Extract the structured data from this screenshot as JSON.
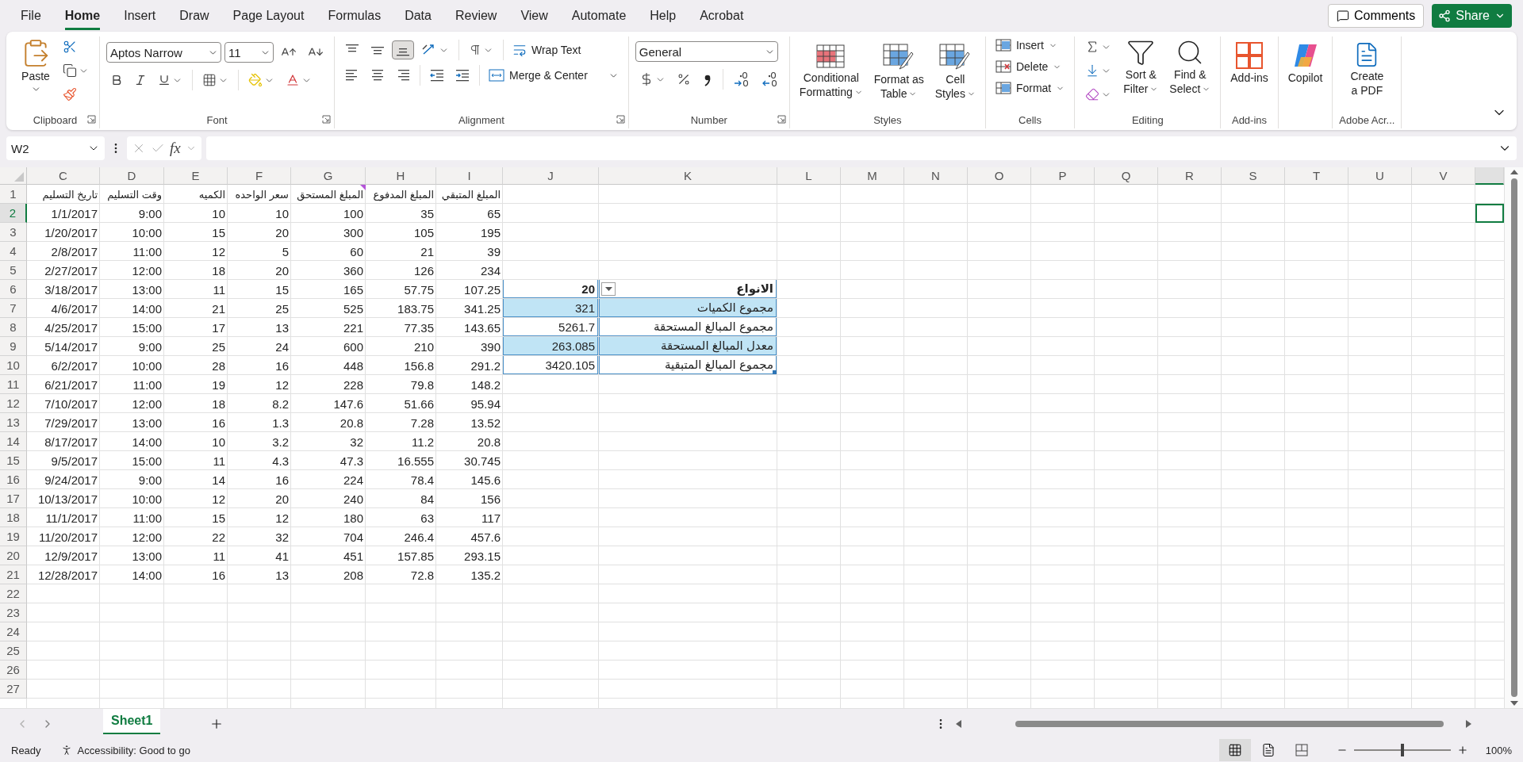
{
  "menu_tabs": [
    {
      "label": "File",
      "selected": false
    },
    {
      "label": "Home",
      "selected": true
    },
    {
      "label": "Insert",
      "selected": false
    },
    {
      "label": "Draw",
      "selected": false
    },
    {
      "label": "Page Layout",
      "selected": false
    },
    {
      "label": "Formulas",
      "selected": false
    },
    {
      "label": "Data",
      "selected": false
    },
    {
      "label": "Review",
      "selected": false
    },
    {
      "label": "View",
      "selected": false
    },
    {
      "label": "Automate",
      "selected": false
    },
    {
      "label": "Help",
      "selected": false
    },
    {
      "label": "Acrobat",
      "selected": false
    }
  ],
  "top_buttons": {
    "comments": "Comments",
    "share": "Share"
  },
  "ribbon": {
    "clipboard": {
      "label": "Clipboard",
      "paste": "Paste"
    },
    "font": {
      "label": "Font",
      "font_name": "Aptos Narrow",
      "font_size": "11"
    },
    "alignment": {
      "label": "Alignment",
      "wrap": "Wrap Text",
      "merge": "Merge & Center"
    },
    "number": {
      "label": "Number",
      "format": "General"
    },
    "styles": {
      "label": "Styles",
      "buttons": [
        [
          "Conditional",
          "Formatting"
        ],
        [
          "Format as",
          "Table"
        ],
        [
          "Cell",
          "Styles"
        ]
      ]
    },
    "cells": {
      "label": "Cells",
      "buttons": [
        "Insert",
        "Delete",
        "Format"
      ]
    },
    "editing": {
      "label": "Editing",
      "buttons": [
        [
          "Sort &",
          "Filter"
        ],
        [
          "Find &",
          "Select"
        ]
      ]
    },
    "addins": {
      "label": "Add-ins",
      "button": "Add-ins"
    },
    "copilot": {
      "button": "Copilot"
    },
    "adobe": {
      "label": "Adobe Acr...",
      "button": [
        "Create",
        "a PDF"
      ]
    }
  },
  "name_box": "W2",
  "function_label": "fx",
  "columns": [
    "C",
    "D",
    "E",
    "F",
    "G",
    "H",
    "I",
    "J",
    "K",
    "L",
    "M",
    "N",
    "O",
    "P",
    "Q",
    "R",
    "S",
    "T",
    "U",
    "V"
  ],
  "rows": [
    {
      "number": "1",
      "selected": false,
      "right_to_left": true,
      "cells": [
        {
          "text": "المبلغ المتبقي",
          "comment": false
        },
        {
          "text": "المبلغ المدفوع",
          "comment": false
        },
        {
          "text": "المبلغ المستحق",
          "comment": true
        },
        {
          "text": "سعر الواحده",
          "comment": false
        },
        {
          "text": "الكميه",
          "comment": false
        },
        {
          "text": "وقت التسليم",
          "comment": false
        },
        {
          "text": "تاريخ التسليم",
          "comment": false
        }
      ]
    },
    {
      "number": "2",
      "selected": true,
      "cells": [
        "1/1/2017",
        "9:00",
        "10",
        "10",
        "100",
        "35",
        "65"
      ]
    },
    {
      "number": "3",
      "selected": false,
      "cells": [
        "1/20/2017",
        "10:00",
        "15",
        "20",
        "300",
        "105",
        "195"
      ]
    },
    {
      "number": "4",
      "selected": false,
      "cells": [
        "2/8/2017",
        "11:00",
        "12",
        "5",
        "60",
        "21",
        "39"
      ]
    },
    {
      "number": "5",
      "selected": false,
      "cells": [
        "2/27/2017",
        "12:00",
        "18",
        "20",
        "360",
        "126",
        "234"
      ]
    },
    {
      "number": "6",
      "selected": false,
      "cells": [
        "3/18/2017",
        "13:00",
        "11",
        "15",
        "165",
        "57.75",
        "107.25"
      ],
      "summary": {
        "kind": "header",
        "value": "20",
        "label": "الانواع",
        "shaded": false
      }
    },
    {
      "number": "7",
      "selected": false,
      "cells": [
        "4/6/2017",
        "14:00",
        "21",
        "25",
        "525",
        "183.75",
        "341.25"
      ],
      "summary": {
        "kind": "row",
        "value": "321",
        "label": "مجموع الكميات",
        "shaded": true
      }
    },
    {
      "number": "8",
      "selected": false,
      "cells": [
        "4/25/2017",
        "15:00",
        "17",
        "13",
        "221",
        "77.35",
        "143.65"
      ],
      "summary": {
        "kind": "row",
        "value": "5261.7",
        "label": "مجموع المبالغ المستحقة",
        "shaded": false
      }
    },
    {
      "number": "9",
      "selected": false,
      "cells": [
        "5/14/2017",
        "9:00",
        "25",
        "24",
        "600",
        "210",
        "390"
      ],
      "summary": {
        "kind": "row",
        "value": "263.085",
        "label": "معدل المبالغ المستحقة",
        "shaded": true
      }
    },
    {
      "number": "10",
      "selected": false,
      "cells": [
        "6/2/2017",
        "10:00",
        "28",
        "16",
        "448",
        "156.8",
        "291.2"
      ],
      "summary": {
        "kind": "row",
        "value": "3420.105",
        "label": "مجموع المبالغ المتبقية",
        "shaded": false
      }
    },
    {
      "number": "11",
      "selected": false,
      "cells": [
        "6/21/2017",
        "11:00",
        "19",
        "12",
        "228",
        "79.8",
        "148.2"
      ]
    },
    {
      "number": "12",
      "selected": false,
      "cells": [
        "7/10/2017",
        "12:00",
        "18",
        "8.2",
        "147.6",
        "51.66",
        "95.94"
      ]
    },
    {
      "number": "13",
      "selected": false,
      "cells": [
        "7/29/2017",
        "13:00",
        "16",
        "1.3",
        "20.8",
        "7.28",
        "13.52"
      ]
    },
    {
      "number": "14",
      "selected": false,
      "cells": [
        "8/17/2017",
        "14:00",
        "10",
        "3.2",
        "32",
        "11.2",
        "20.8"
      ]
    },
    {
      "number": "15",
      "selected": false,
      "cells": [
        "9/5/2017",
        "15:00",
        "11",
        "4.3",
        "47.3",
        "16.555",
        "30.745"
      ]
    },
    {
      "number": "16",
      "selected": false,
      "cells": [
        "9/24/2017",
        "9:00",
        "14",
        "16",
        "224",
        "78.4",
        "145.6"
      ]
    },
    {
      "number": "17",
      "selected": false,
      "cells": [
        "10/13/2017",
        "10:00",
        "12",
        "20",
        "240",
        "84",
        "156"
      ]
    },
    {
      "number": "18",
      "selected": false,
      "cells": [
        "11/1/2017",
        "11:00",
        "15",
        "12",
        "180",
        "63",
        "117"
      ]
    },
    {
      "number": "19",
      "selected": false,
      "cells": [
        "11/20/2017",
        "12:00",
        "22",
        "32",
        "704",
        "246.4",
        "457.6"
      ]
    },
    {
      "number": "20",
      "selected": false,
      "cells": [
        "12/9/2017",
        "13:00",
        "11",
        "41",
        "451",
        "157.85",
        "293.15"
      ]
    },
    {
      "number": "21",
      "selected": false,
      "cells": [
        "12/28/2017",
        "14:00",
        "16",
        "13",
        "208",
        "72.8",
        "135.2"
      ]
    },
    {
      "number": "22",
      "selected": false,
      "cells": []
    },
    {
      "number": "23",
      "selected": false,
      "cells": []
    },
    {
      "number": "24",
      "selected": false,
      "cells": []
    },
    {
      "number": "25",
      "selected": false,
      "cells": []
    },
    {
      "number": "26",
      "selected": false,
      "cells": []
    },
    {
      "number": "27",
      "selected": false,
      "cells": []
    }
  ],
  "sheet_tabs": [
    {
      "label": "Sheet1",
      "selected": true
    }
  ],
  "status_bar": {
    "mode": "Ready",
    "accessibility": "Accessibility: Good to go",
    "views": [
      {
        "selected": true
      },
      {
        "selected": false
      },
      {
        "selected": false
      }
    ],
    "zoom": {
      "level": 0.5,
      "reading": "100%"
    }
  }
}
